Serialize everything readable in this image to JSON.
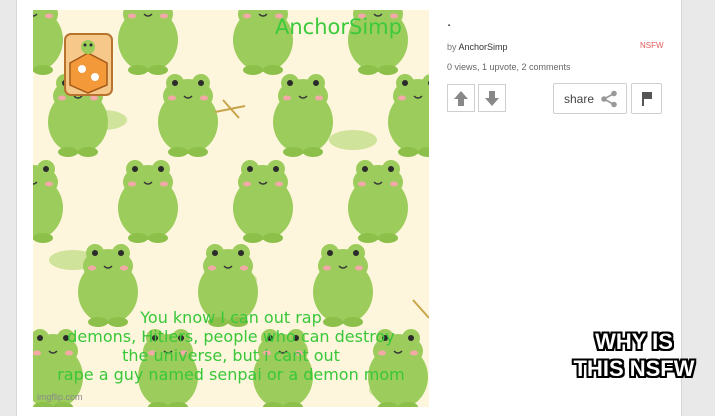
{
  "meme": {
    "title_text": "AnchorSimp",
    "caption_lines": [
      "You know I can out rap",
      "demons, Hitlers, people who can destroy",
      "the universe, but i cant out",
      "rape a guy named senpai or a demon mom"
    ],
    "watermark": "imgflip.com"
  },
  "post": {
    "title": ".",
    "by_prefix": "by ",
    "author": "AnchorSimp",
    "nsfw_label": "NSFW",
    "stats": "0 views, 1 upvote, 2 comments",
    "share_label": "share"
  },
  "overlay": {
    "line1": "WHY IS",
    "line2": "THIS NSFW"
  },
  "colors": {
    "frog_green": "#9ccd5c",
    "caption_green": "#39c739",
    "background_cream": "#fdf6dd",
    "nsfw_red": "#e35a5a"
  }
}
